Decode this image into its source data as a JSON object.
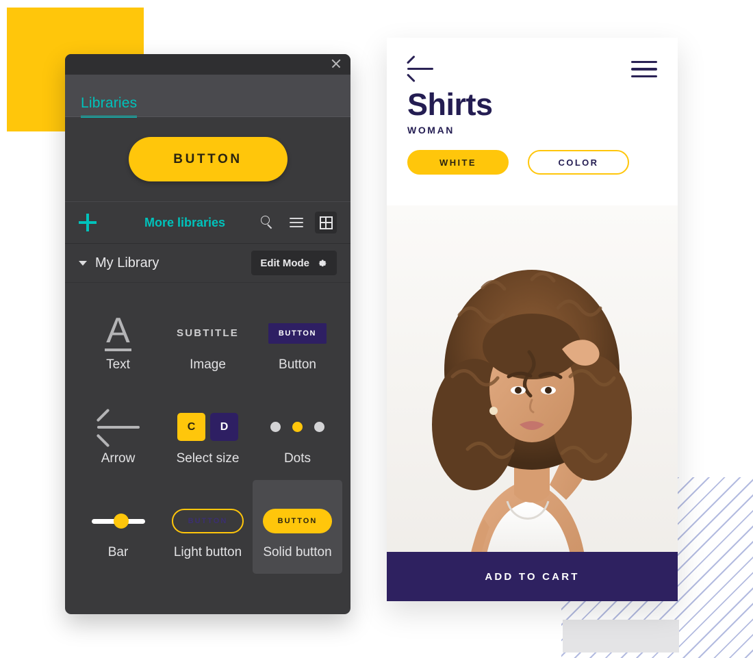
{
  "panel": {
    "close_icon": "close-icon",
    "tabs": [
      {
        "label": "Libraries",
        "active": true
      }
    ],
    "hero_button_label": "BUTTON",
    "toolbar": {
      "add_icon": "plus-icon",
      "more_libraries_label": "More libraries",
      "search_icon": "search-icon",
      "list_view_icon": "list-icon",
      "grid_view_icon": "grid-icon"
    },
    "library_row": {
      "chevron_icon": "chevron-down-icon",
      "name": "My Library",
      "edit_mode_label": "Edit Mode",
      "gear_icon": "gear-icon"
    },
    "items": [
      {
        "label": "Text",
        "preview": "A",
        "kind": "text"
      },
      {
        "label": "Image",
        "preview": "SUBTITLE",
        "kind": "subtitle"
      },
      {
        "label": "Button",
        "preview": "BUTTON",
        "kind": "chip-dark"
      },
      {
        "label": "Arrow",
        "preview": "",
        "kind": "arrow"
      },
      {
        "label": "Select size",
        "preview": "",
        "kind": "sizes",
        "tiles": [
          "C",
          "D"
        ]
      },
      {
        "label": "Dots",
        "preview": "",
        "kind": "dots",
        "dot_count": 3,
        "active_dot": 1
      },
      {
        "label": "Bar",
        "preview": "",
        "kind": "bar"
      },
      {
        "label": "Light button",
        "preview": "BUTTON",
        "kind": "chip-light"
      },
      {
        "label": "Solid button",
        "preview": "BUTTON",
        "kind": "chip-solid",
        "selected": true
      }
    ]
  },
  "phone": {
    "back_icon": "back-arrow-icon",
    "menu_icon": "menu-icon",
    "title": "Shirts",
    "subtitle": "WOMAN",
    "filters": [
      {
        "label": "WHITE",
        "active": true
      },
      {
        "label": "COLOR",
        "active": false
      }
    ],
    "photo_alt": "woman-in-white-tank-top",
    "add_to_cart_label": "ADD TO CART"
  },
  "colors": {
    "yellow": "#FFC60B",
    "teal": "#00C2BB",
    "purple": "#2E2160",
    "panel_bg": "#3A3A3C",
    "stripe": "#9AA4D6"
  }
}
